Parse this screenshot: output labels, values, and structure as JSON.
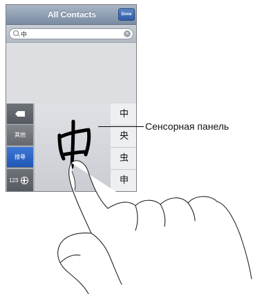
{
  "navbar": {
    "title": "All Contacts",
    "done_label": "Done"
  },
  "search": {
    "query": "中"
  },
  "keyboard": {
    "other_label": "其他",
    "search_label": "搜尋",
    "numbers_label": "123",
    "candidates": [
      "中",
      "央",
      "虫",
      "申"
    ]
  },
  "callout": {
    "label": "Сенсорная панель"
  },
  "colors": {
    "accent": "#2c5ea8",
    "navbar": "#8fa0b6",
    "keyboard": "#aeb2b9"
  }
}
